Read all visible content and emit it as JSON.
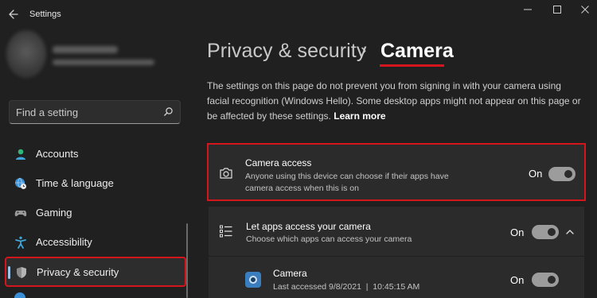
{
  "window": {
    "app_title": "Settings"
  },
  "search": {
    "placeholder": "Find a setting",
    "icon": "search-icon"
  },
  "sidebar": {
    "items": [
      {
        "label": "Accounts",
        "icon": "accounts-icon"
      },
      {
        "label": "Time & language",
        "icon": "globe-clock-icon"
      },
      {
        "label": "Gaming",
        "icon": "gamepad-icon"
      },
      {
        "label": "Accessibility",
        "icon": "accessibility-icon"
      },
      {
        "label": "Privacy & security",
        "icon": "shield-icon",
        "active": true
      }
    ]
  },
  "header": {
    "parent": "Privacy & security",
    "separator": "›",
    "current": "Camera"
  },
  "description": {
    "text": "The settings on this page do not prevent you from signing in with your camera using facial recognition (Windows Hello). Some desktop apps might not appear on this page or be affected by these settings.",
    "link": "Learn more"
  },
  "camera_access": {
    "title": "Camera access",
    "subtitle_line1": "Anyone using this device can choose if their apps have",
    "subtitle_line2": "camera access when this is on",
    "state": "On",
    "icon": "camera-icon"
  },
  "let_apps": {
    "title": "Let apps access your camera",
    "subtitle": "Choose which apps can access your camera",
    "state": "On",
    "icon": "list-icon"
  },
  "apps": [
    {
      "name": "Camera",
      "last_accessed": "Last accessed 9/8/2021  |  10:45:15 AM",
      "state": "On",
      "icon": "camera-app-icon"
    }
  ],
  "colors": {
    "accent_red": "#d4151c",
    "background": "#202020",
    "card": "#2b2b2b",
    "active_indicator": "#9ec5e8"
  }
}
